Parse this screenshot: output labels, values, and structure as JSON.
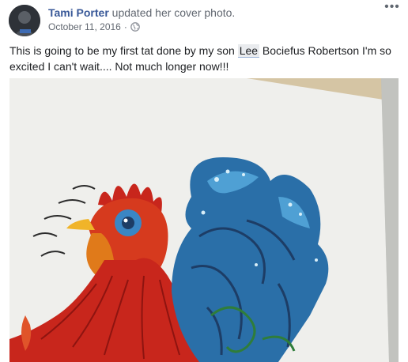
{
  "post": {
    "author_name": "Tami Porter",
    "action_text": " updated her cover photo.",
    "date": "October 11, 2016",
    "separator": "·",
    "privacy_icon": "globe-icon",
    "more_icon": "more-options-icon",
    "more_glyph": "•••",
    "text_before": "This is going to be my first tat done by my son ",
    "mention": "Lee",
    "text_after": " Bociefus Robertson I'm so excited I can't wait.... Not much longer now!!!"
  },
  "photo": {
    "subject_icon": "rooster-tattoo-drawing",
    "colors": {
      "link": "#385898",
      "rooster_red": "#c8261c",
      "rooster_orange": "#e07a1a",
      "feather_blue": "#2a6fa8",
      "feather_dark": "#1d3d66",
      "paper": "#f1f1ef"
    }
  }
}
